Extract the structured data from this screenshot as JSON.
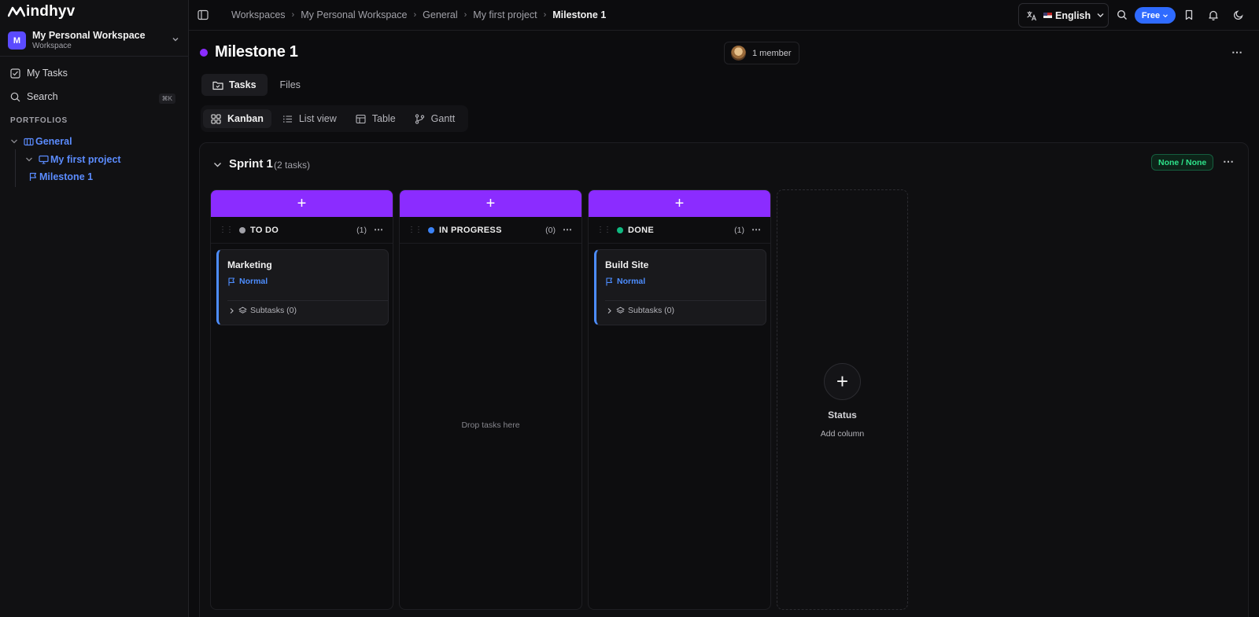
{
  "app": {
    "logo_text": "indhyv"
  },
  "workspace": {
    "avatar_letter": "M",
    "name": "My Personal Workspace",
    "subtitle": "Workspace"
  },
  "sidebar": {
    "my_tasks": "My Tasks",
    "search": "Search",
    "search_shortcut": "⌘K",
    "section_label": "PORTFOLIOS",
    "tree": {
      "portfolio": "General",
      "project": "My first project",
      "milestone": "Milestone 1"
    }
  },
  "topbar": {
    "breadcrumbs": [
      "Workspaces",
      "My Personal Workspace",
      "General",
      "My first project",
      "Milestone 1"
    ],
    "language": "English",
    "plan": "Free"
  },
  "header": {
    "title": "Milestone 1",
    "members": "1 member",
    "tabs": [
      "Tasks",
      "Files"
    ],
    "views": [
      "Kanban",
      "List view",
      "Table",
      "Gantt"
    ]
  },
  "sprint": {
    "name": "Sprint 1",
    "task_count": "(2 tasks)",
    "range": "None / None"
  },
  "columns": [
    {
      "name": "TO DO",
      "count": "(1)",
      "color": "#a1a1a8",
      "card": {
        "title": "Marketing",
        "priority": "Normal",
        "subtasks": "Subtasks (0)"
      }
    },
    {
      "name": "IN PROGRESS",
      "count": "(0)",
      "color": "#3b82f6",
      "empty_text": "Drop tasks here"
    },
    {
      "name": "DONE",
      "count": "(1)",
      "color": "#10b981",
      "card": {
        "title": "Build Site",
        "priority": "Normal",
        "subtasks": "Subtasks (0)"
      }
    }
  ],
  "add_column": {
    "title": "Status",
    "subtitle": "Add column"
  },
  "colors": {
    "accent": "#8b2cff",
    "primary": "#2f6bff",
    "link": "#5b8cff",
    "badge_green": "#2ee28a"
  }
}
